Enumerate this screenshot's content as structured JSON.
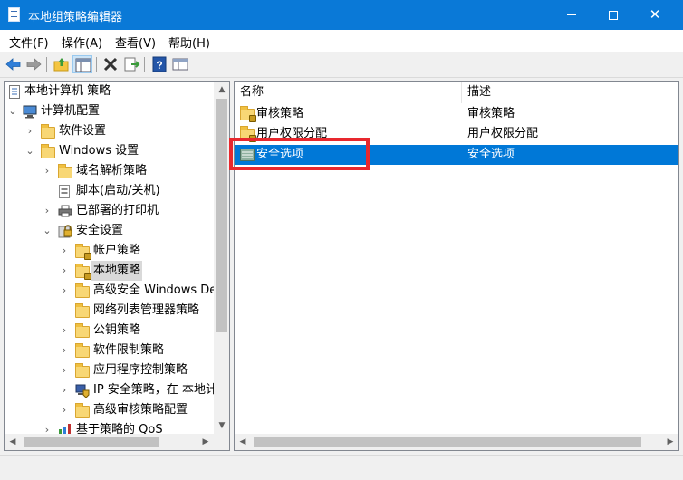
{
  "window": {
    "title": "本地组策略编辑器"
  },
  "menu": {
    "file": "文件(F)",
    "action": "操作(A)",
    "view": "查看(V)",
    "help": "帮助(H)"
  },
  "tree": {
    "root": "本地计算机 策略",
    "computer_config": "计算机配置",
    "software_settings": "软件设置",
    "windows_settings": "Windows 设置",
    "dns_policy": "域名解析策略",
    "scripts": "脚本(启动/关机)",
    "printers": "已部署的打印机",
    "security_settings": "安全设置",
    "account_policy": "帐户策略",
    "local_policy": "本地策略",
    "advanced_firewall": "高级安全 Windows Defender 防火墙",
    "network_list": "网络列表管理器策略",
    "public_key": "公钥策略",
    "software_restriction": "软件限制策略",
    "app_control": "应用程序控制策略",
    "ip_security": "IP 安全策略，在 本地计算机",
    "advanced_audit": "高级审核策略配置",
    "qos": "基于策略的 QoS"
  },
  "list": {
    "col_name": "名称",
    "col_desc": "描述",
    "rows": [
      {
        "name": "审核策略",
        "desc": "审核策略"
      },
      {
        "name": "用户权限分配",
        "desc": "用户权限分配"
      },
      {
        "name": "安全选项",
        "desc": "安全选项"
      }
    ],
    "selected_index": 2
  },
  "colors": {
    "title_bar": "#0a79d7",
    "selection": "#0078d7",
    "annotation_box": "#e8282e"
  }
}
